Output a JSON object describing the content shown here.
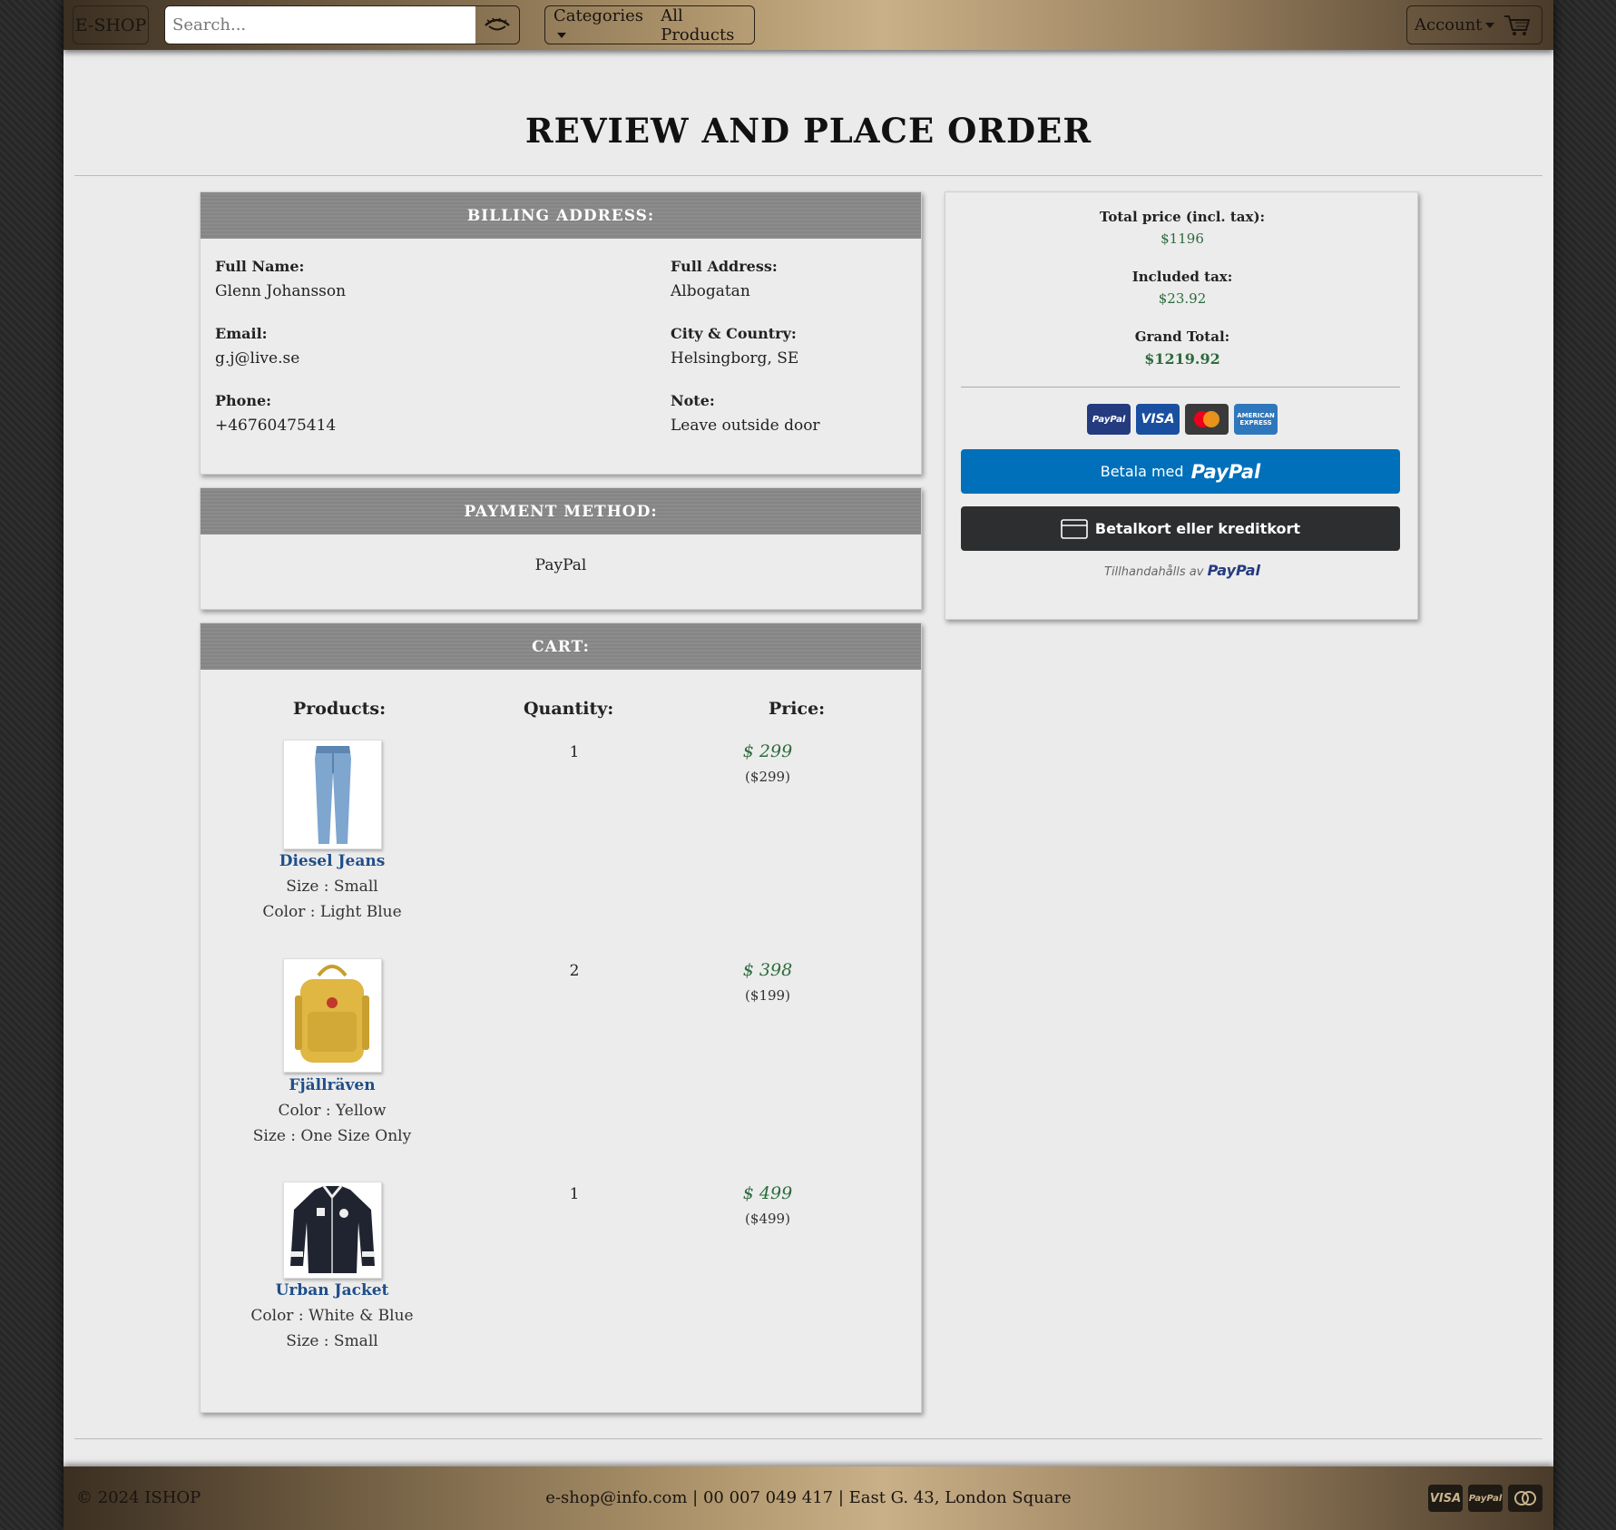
{
  "nav": {
    "brand": "E-SHOP",
    "search_placeholder": "Search...",
    "categories_label": "Categories",
    "all_products_label": "All Products",
    "account_label": "Account"
  },
  "page_title": "REVIEW AND PLACE ORDER",
  "billing": {
    "heading": "BILLING ADDRESS:",
    "full_name_label": "Full Name:",
    "full_name": "Glenn Johansson",
    "email_label": "Email:",
    "email": "g.j@live.se",
    "phone_label": "Phone:",
    "phone": "+46760475414",
    "full_address_label": "Full Address:",
    "full_address": "Albogatan",
    "city_country_label": "City & Country:",
    "city_country": "Helsingborg, SE",
    "note_label": "Note:",
    "note": "Leave outside door"
  },
  "payment": {
    "heading": "PAYMENT METHOD:",
    "method": "PayPal"
  },
  "cart": {
    "heading": "CART:",
    "col_products": "Products:",
    "col_quantity": "Quantity:",
    "col_price": "Price:",
    "items": [
      {
        "name": "Diesel Jeans",
        "attr1": "Size : Small",
        "attr2": "Color : Light Blue",
        "quantity": "1",
        "price": "$ 299",
        "unit_price": "($299)",
        "image": "jeans"
      },
      {
        "name": "Fjällräven",
        "attr1": "Color : Yellow",
        "attr2": "Size : One Size Only",
        "quantity": "2",
        "price": "$ 398",
        "unit_price": "($199)",
        "image": "backpack"
      },
      {
        "name": "Urban Jacket",
        "attr1": "Color : White & Blue",
        "attr2": "Size : Small",
        "quantity": "1",
        "price": "$ 499",
        "unit_price": "($499)",
        "image": "jacket"
      }
    ]
  },
  "summary": {
    "total_label": "Total price (incl. tax):",
    "total": "$1196",
    "tax_label": "Included tax:",
    "tax": "$23.92",
    "grand_label": "Grand Total:",
    "grand": "$1219.92",
    "payment_logos": [
      "PayPal",
      "VISA",
      "mastercard",
      "AMERICAN EXPRESS"
    ],
    "paypal_button_prefix": "Betala med",
    "paypal_word": "PayPal",
    "card_button": "Betalkort eller kreditkort",
    "powered_prefix": "Tillhandahålls av",
    "powered_brand": "PayPal"
  },
  "footer": {
    "copyright": "© 2024 ISHOP",
    "contact": "e-shop@info.com | 00 007 049 417 | East G. 43, London Square",
    "icons": [
      "VISA",
      "PayPal",
      "mastercard"
    ]
  },
  "colors": {
    "price_green": "#2c6b3c",
    "link_blue": "#1f4e8a",
    "paypal_blue": "#0070ba",
    "header_gray": "#8a8a8a"
  }
}
